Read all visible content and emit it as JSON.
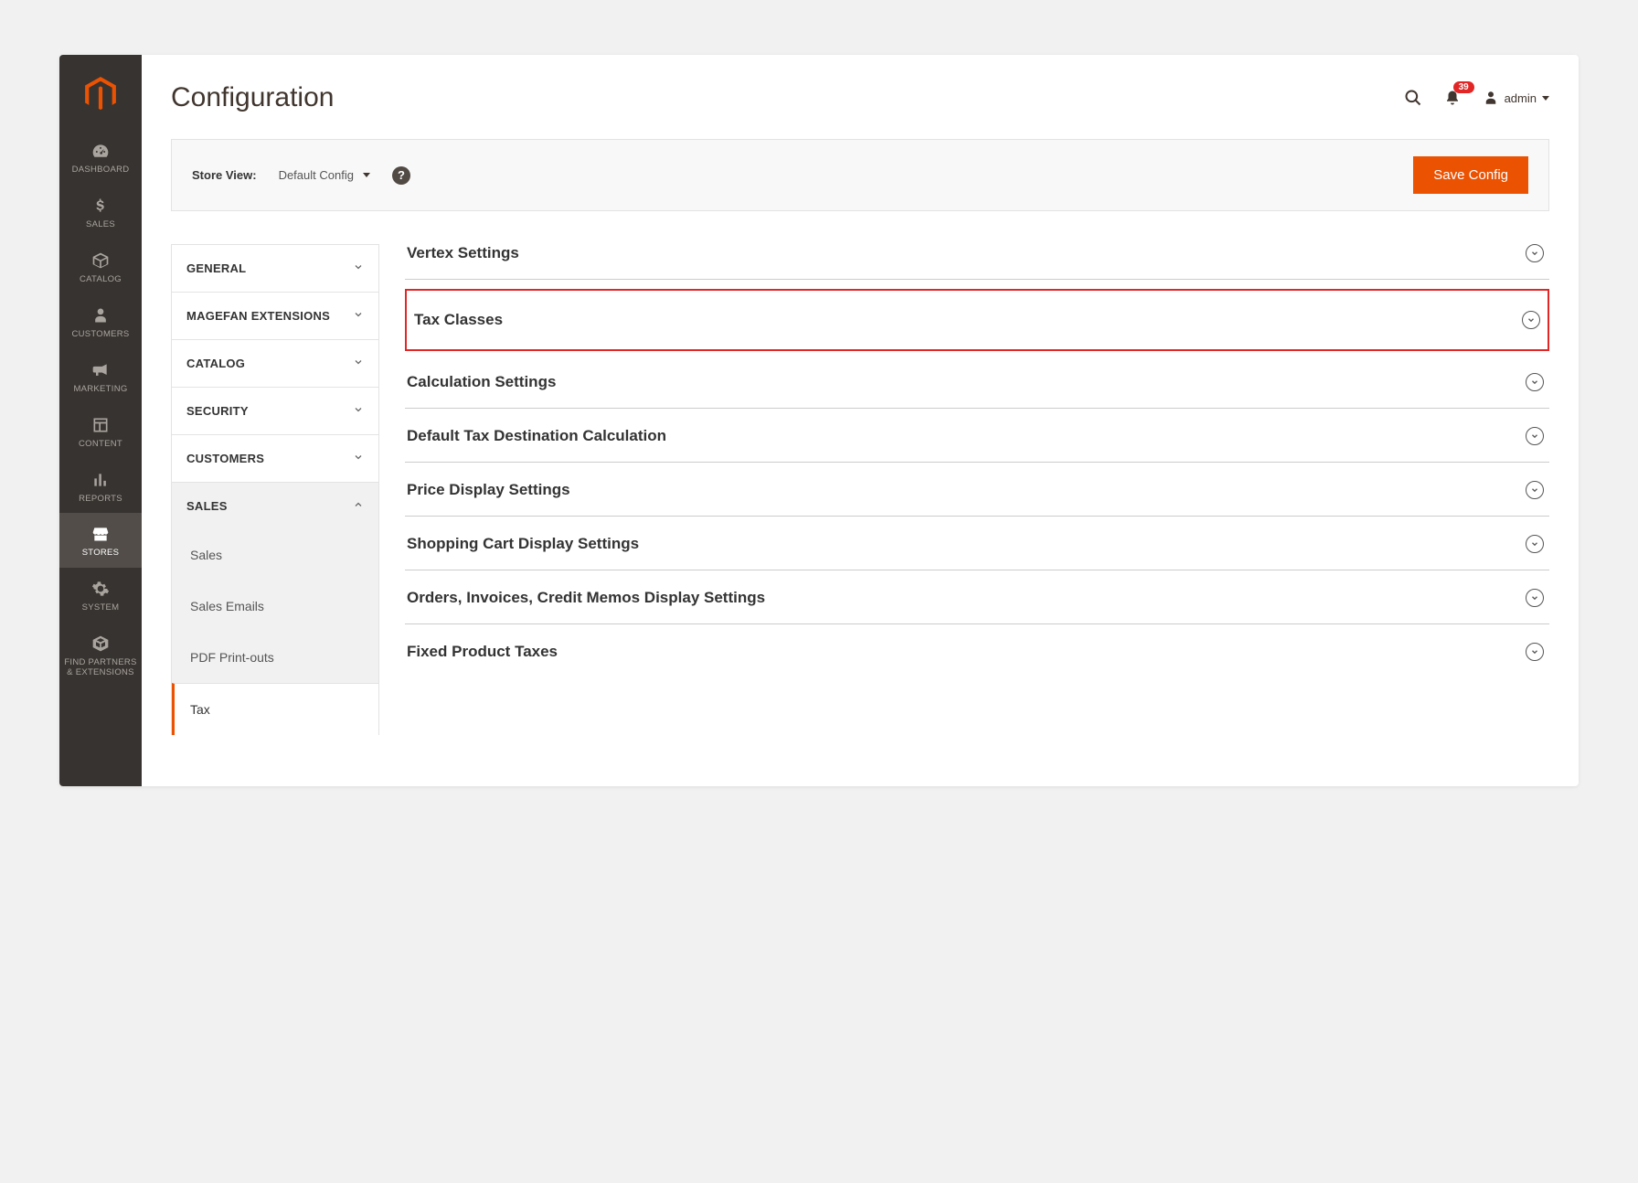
{
  "page": {
    "title": "Configuration"
  },
  "header": {
    "notification_count": "39",
    "username": "admin"
  },
  "store_bar": {
    "label": "Store View:",
    "selected": "Default Config",
    "save_button": "Save Config"
  },
  "sidebar": {
    "items": [
      {
        "label": "DASHBOARD"
      },
      {
        "label": "SALES"
      },
      {
        "label": "CATALOG"
      },
      {
        "label": "CUSTOMERS"
      },
      {
        "label": "MARKETING"
      },
      {
        "label": "CONTENT"
      },
      {
        "label": "REPORTS"
      },
      {
        "label": "STORES"
      },
      {
        "label": "SYSTEM"
      },
      {
        "label": "FIND PARTNERS & EXTENSIONS"
      }
    ]
  },
  "config_tabs": [
    {
      "label": "GENERAL",
      "expanded": false
    },
    {
      "label": "MAGEFAN EXTENSIONS",
      "expanded": false
    },
    {
      "label": "CATALOG",
      "expanded": false
    },
    {
      "label": "SECURITY",
      "expanded": false
    },
    {
      "label": "CUSTOMERS",
      "expanded": false
    },
    {
      "label": "SALES",
      "expanded": true
    }
  ],
  "sales_subitems": [
    {
      "label": "Sales"
    },
    {
      "label": "Sales Emails"
    },
    {
      "label": "PDF Print-outs"
    },
    {
      "label": "Tax",
      "active": true
    }
  ],
  "sections": [
    {
      "label": "Vertex Settings"
    },
    {
      "label": "Tax Classes",
      "highlighted": true
    },
    {
      "label": "Calculation Settings"
    },
    {
      "label": "Default Tax Destination Calculation"
    },
    {
      "label": "Price Display Settings"
    },
    {
      "label": "Shopping Cart Display Settings"
    },
    {
      "label": "Orders, Invoices, Credit Memos Display Settings"
    },
    {
      "label": "Fixed Product Taxes"
    }
  ]
}
